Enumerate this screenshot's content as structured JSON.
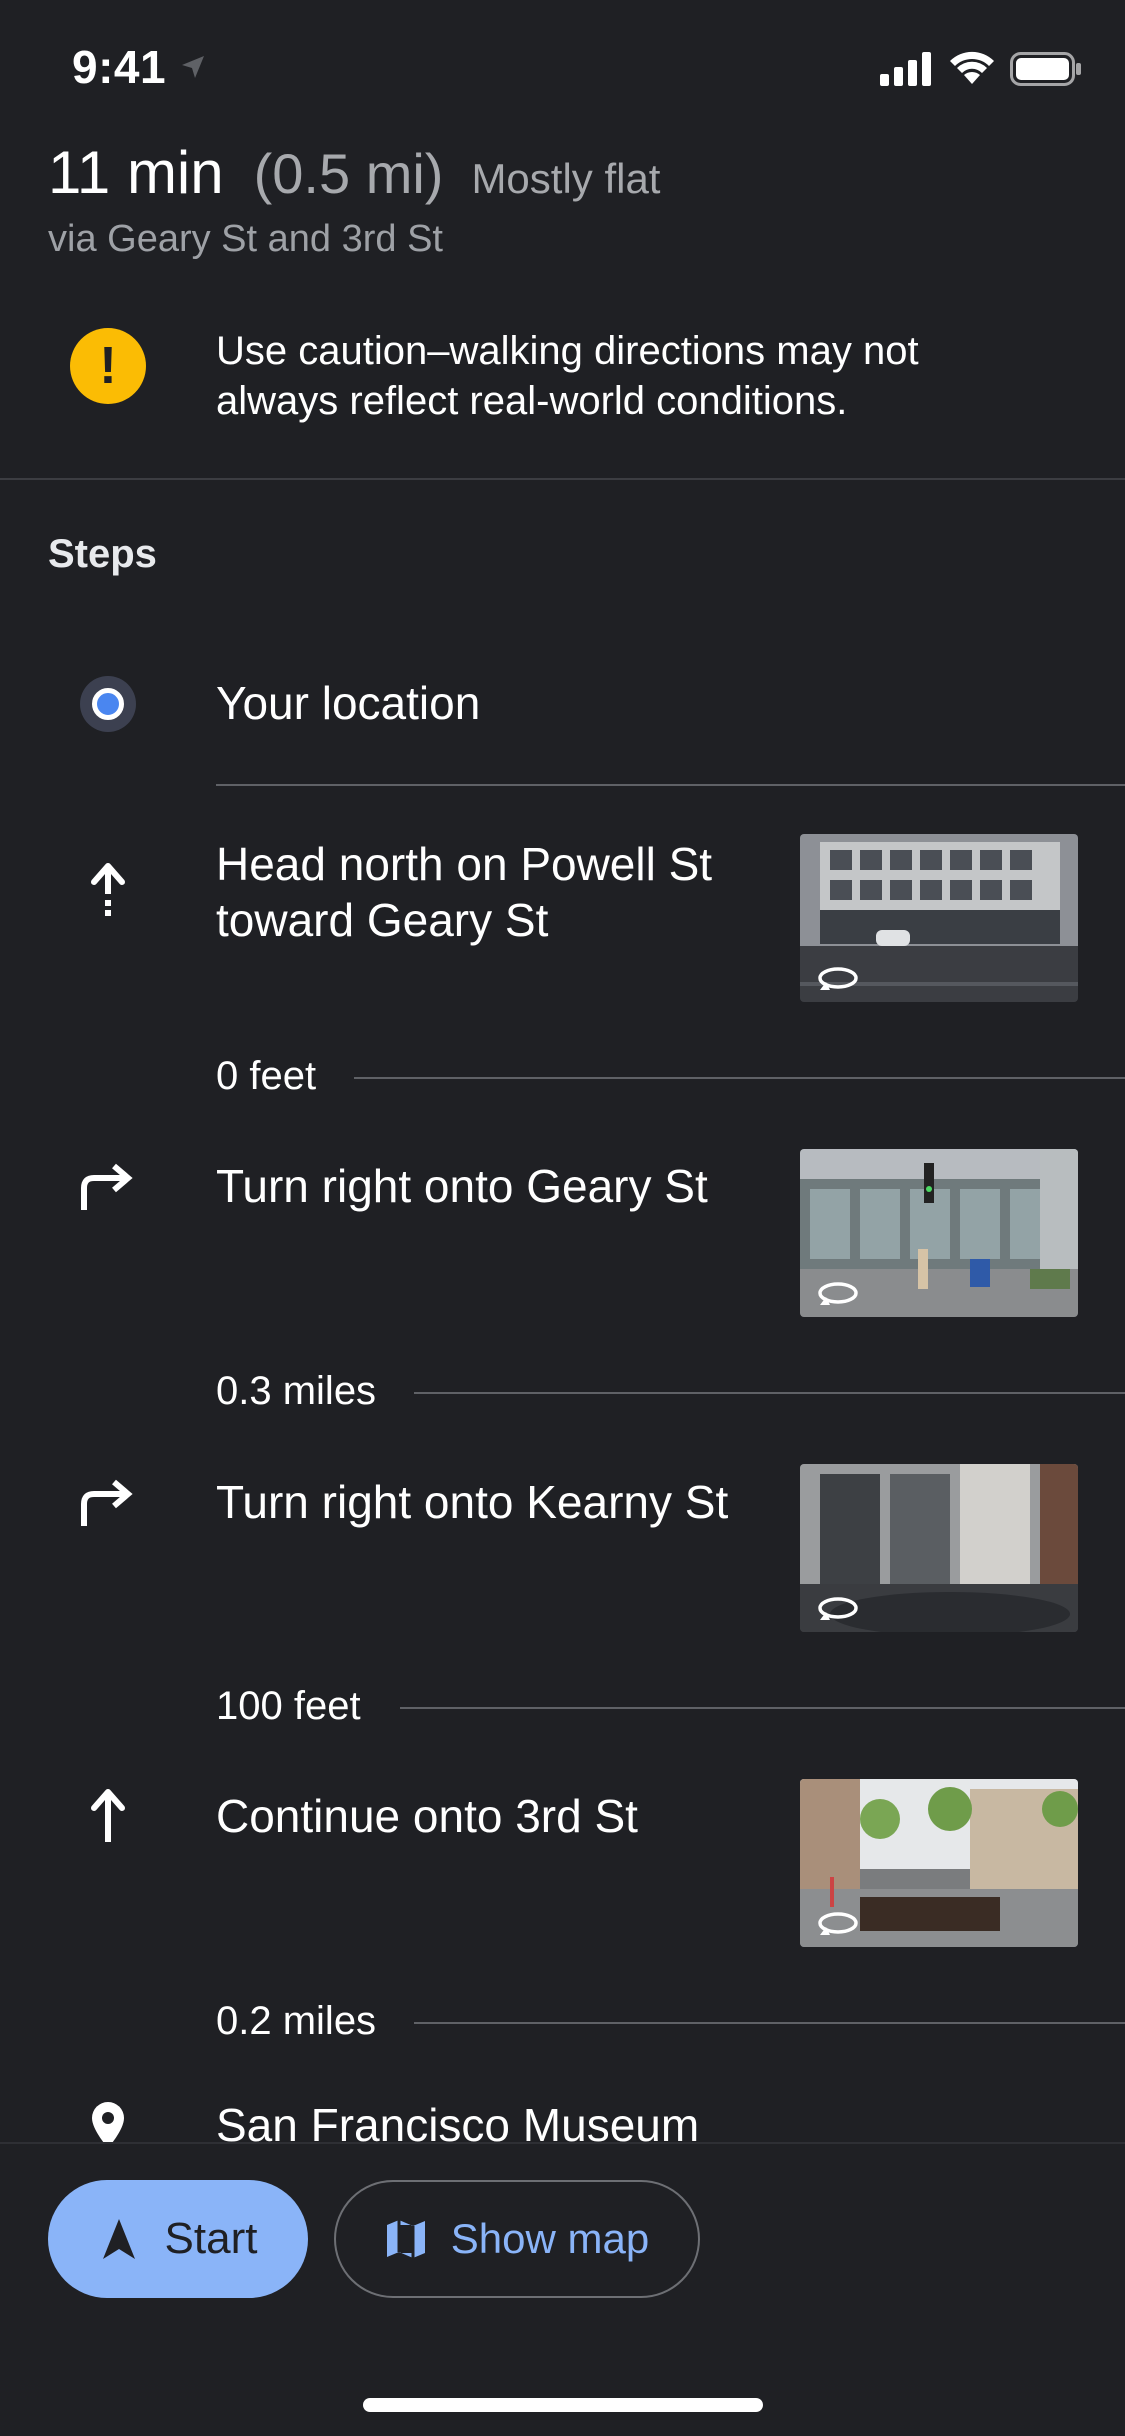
{
  "status": {
    "time": "9:41"
  },
  "summary": {
    "duration": "11 min",
    "distance": "(0.5 mi)",
    "terrain": "Mostly flat",
    "via": "via Geary St and 3rd St"
  },
  "warning": {
    "icon_glyph": "!",
    "text": "Use caution–walking directions may not always reflect real-world conditions."
  },
  "steps_heading": "Steps",
  "origin": {
    "label": "Your location"
  },
  "steps": [
    {
      "icon": "straight-dashed-arrow-icon",
      "text": "Head north on Powell St toward Geary St",
      "distance": "0 feet"
    },
    {
      "icon": "turn-right-icon",
      "text": "Turn right onto Geary St",
      "distance": "0.3 miles"
    },
    {
      "icon": "turn-right-icon",
      "text": "Turn right onto Kearny St",
      "distance": "100 feet"
    },
    {
      "icon": "straight-arrow-icon",
      "text": "Continue onto 3rd St",
      "distance": "0.2 miles"
    }
  ],
  "destination": {
    "label": "San Francisco Museum"
  },
  "buttons": {
    "start": "Start",
    "show_map": "Show map"
  },
  "colors": {
    "accent": "#8ab4f8",
    "warning": "#fbbc04",
    "background": "#1f2024",
    "location_blue": "#4a86f0"
  }
}
